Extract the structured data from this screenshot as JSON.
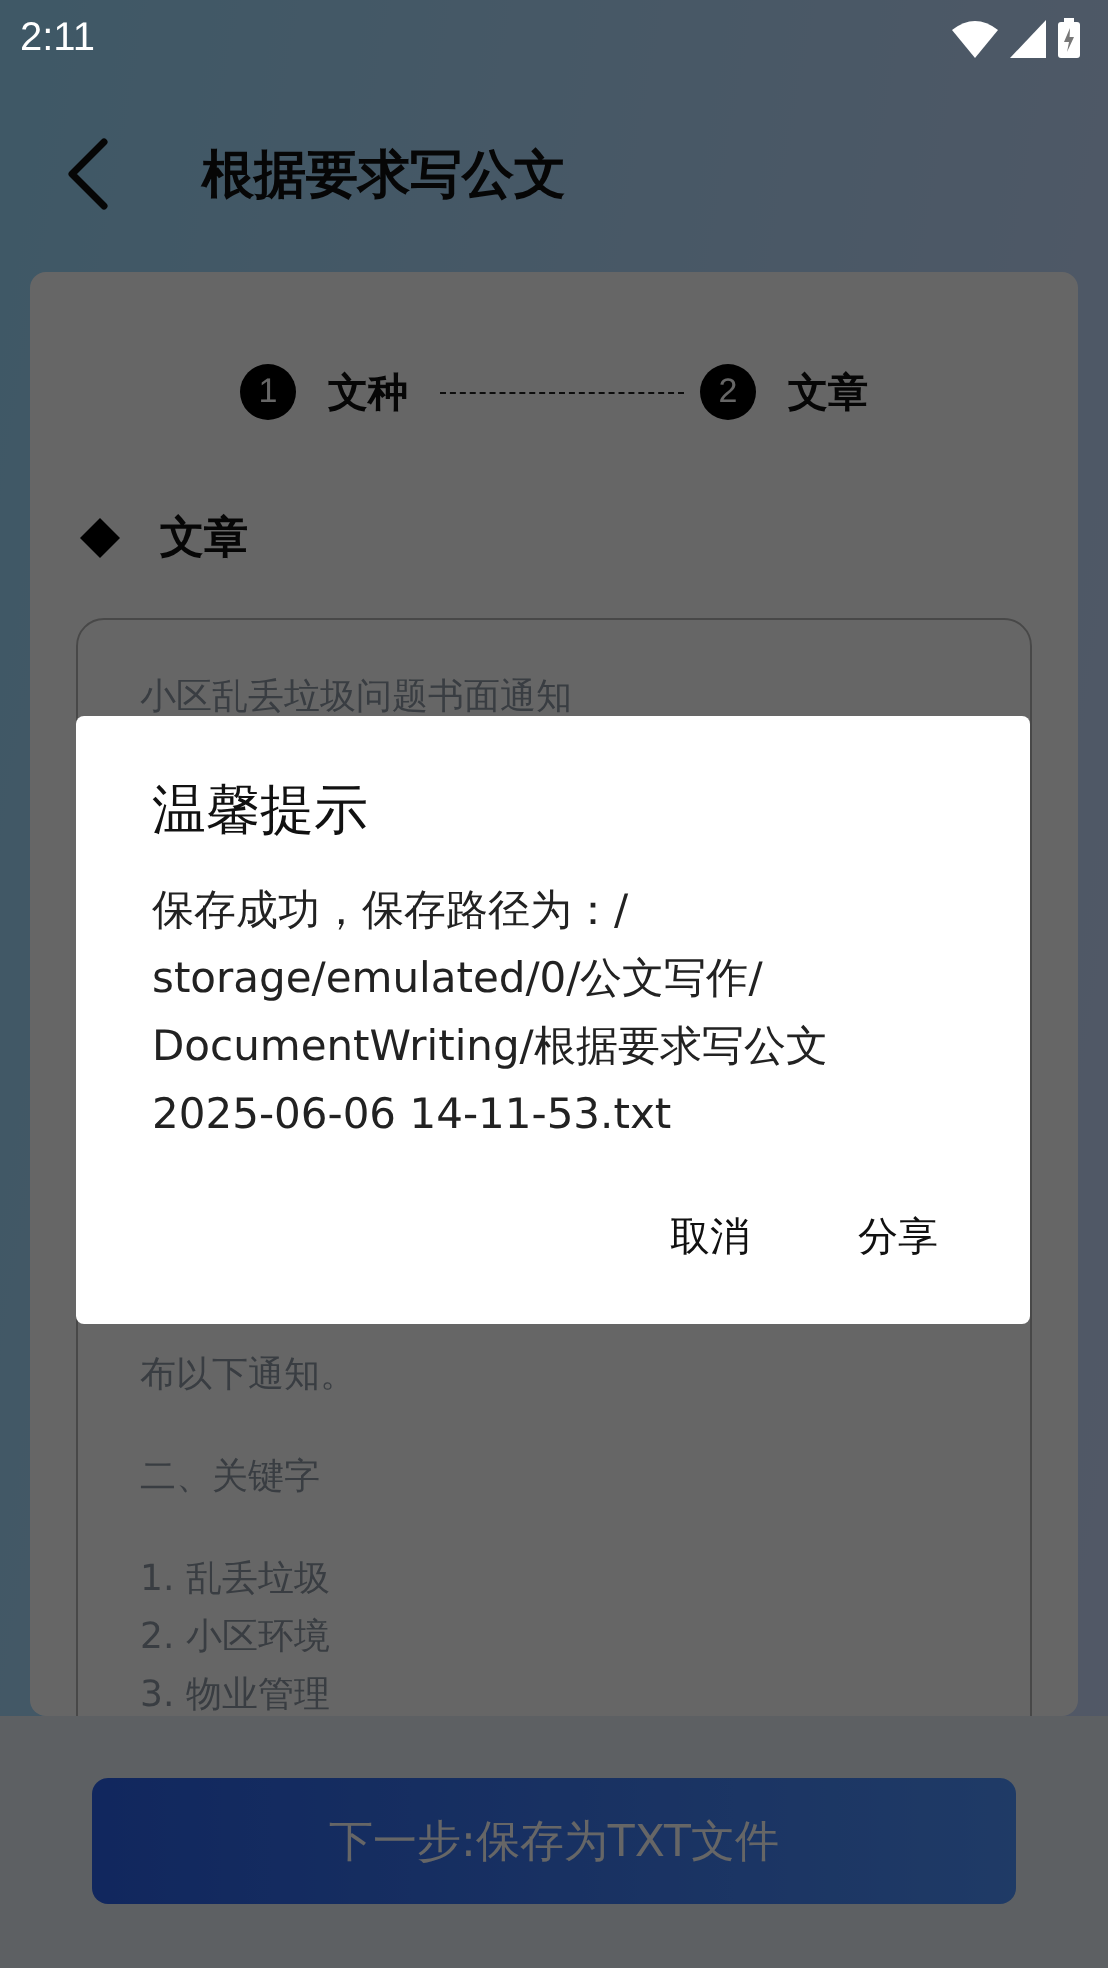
{
  "status_bar": {
    "time": "2:11"
  },
  "header": {
    "title": "根据要求写公文"
  },
  "stepper": [
    {
      "number": "1",
      "label": "文种"
    },
    {
      "number": "2",
      "label": "文章"
    }
  ],
  "section": {
    "title": "文章"
  },
  "article": {
    "title": "小区乱丢垃圾问题书面通知",
    "paragraphs": [
      [
        "布以下通知。"
      ],
      [
        "二、关键字"
      ],
      [
        "1. 乱丢垃圾",
        "2. 小区环境",
        "3. 物业管理"
      ]
    ]
  },
  "next_button": {
    "label": "下一步:保存为TXT文件"
  },
  "dialog": {
    "title": "温馨提示",
    "message_lines": [
      "保存成功，保存路径为：/",
      "storage/emulated/0/公文写作/",
      "DocumentWriting/根据要求写公文",
      "2025-06-06 14-11-53.txt"
    ],
    "buttons": [
      "取消",
      "分享"
    ]
  }
}
